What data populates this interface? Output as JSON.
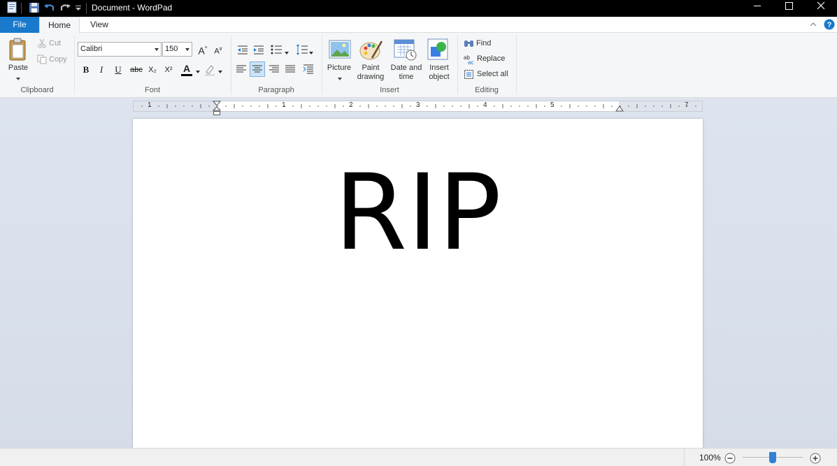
{
  "window": {
    "title": "Document - WordPad"
  },
  "tabs": {
    "file": "File",
    "home": "Home",
    "view": "View"
  },
  "clipboard": {
    "paste": "Paste",
    "cut": "Cut",
    "copy": "Copy",
    "group_label": "Clipboard"
  },
  "font": {
    "family": "Calibri",
    "size": "150",
    "group_label": "Font",
    "bold": "B",
    "italic": "I",
    "underline": "U",
    "strikethrough": "abc",
    "subscript": "X₂",
    "superscript": "X²",
    "color_letter": "A",
    "grow": "A",
    "shrink": "A"
  },
  "paragraph": {
    "group_label": "Paragraph"
  },
  "insert": {
    "picture": "Picture",
    "paint_line1": "Paint",
    "paint_line2": "drawing",
    "date_line1": "Date and",
    "date_line2": "time",
    "object_line1": "Insert",
    "object_line2": "object",
    "group_label": "Insert"
  },
  "editing": {
    "find": "Find",
    "replace": "Replace",
    "select_all": "Select all",
    "group_label": "Editing"
  },
  "ruler": {
    "numbers": [
      "1",
      "1",
      "2",
      "3",
      "4",
      "5",
      "7"
    ]
  },
  "document": {
    "text": "RIP"
  },
  "status": {
    "zoom": "100%"
  },
  "colors": {
    "accent": "#1979ca",
    "title_bar": "#000000",
    "ribbon_bg": "#f5f6f7",
    "doc_bg": "#d9e0eb"
  }
}
